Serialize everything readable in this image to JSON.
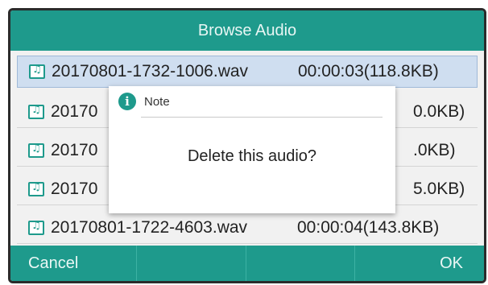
{
  "header": {
    "title": "Browse Audio"
  },
  "files": [
    {
      "name": "20170801-1732-1006.wav",
      "meta": "00:00:03(118.8KB)",
      "selected": true
    },
    {
      "name": "20170",
      "meta": "0.0KB)",
      "selected": false
    },
    {
      "name": "20170",
      "meta": ".0KB)",
      "selected": false
    },
    {
      "name": "20170",
      "meta": "5.0KB)",
      "selected": false
    },
    {
      "name": "20170801-1722-4603.wav",
      "meta": "00:00:04(143.8KB)",
      "selected": false
    }
  ],
  "dialog": {
    "title": "Note",
    "message": "Delete this audio?",
    "icon": "info-icon"
  },
  "softkeys": {
    "left": "Cancel",
    "right": "OK"
  },
  "colors": {
    "accent": "#1e9a8c",
    "selected_row": "#cfdef0"
  }
}
